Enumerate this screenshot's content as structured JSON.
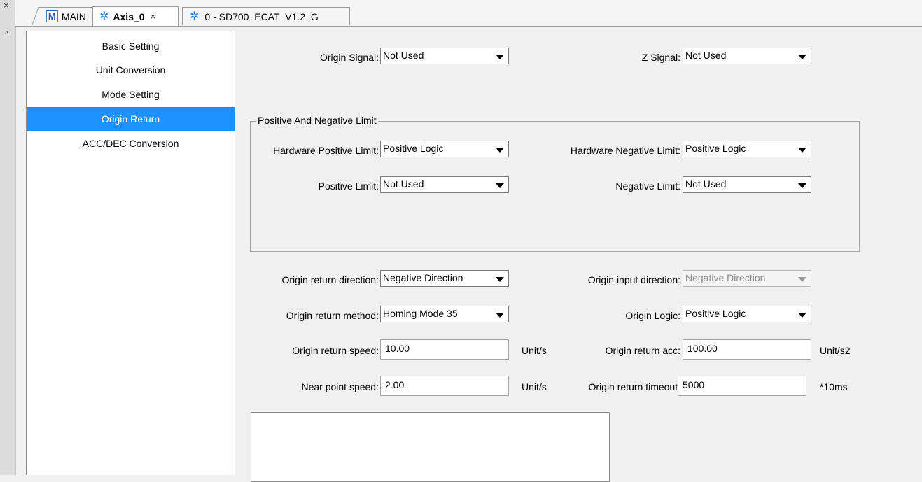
{
  "tabs": {
    "main_label": "MAIN",
    "axis_label": "Axis_0",
    "device_label": "0 - SD700_ECAT_V1.2_G",
    "close_glyph": "×"
  },
  "nav": {
    "items": [
      {
        "label": "Basic Setting"
      },
      {
        "label": "Unit Conversion"
      },
      {
        "label": "Mode Setting"
      },
      {
        "label": "Origin Return"
      },
      {
        "label": "ACC/DEC Conversion"
      }
    ],
    "selected_index": 3,
    "selected_color": "#1e90ff"
  },
  "form": {
    "origin_signal": {
      "label": "Origin Signal:",
      "value": "Not Used"
    },
    "z_signal": {
      "label": "Z Signal:",
      "value": "Not Used"
    },
    "limit_group": {
      "title": "Positive And Negative Limit",
      "hw_pos_limit": {
        "label": "Hardware Positive Limit:",
        "value": "Positive Logic"
      },
      "hw_neg_limit": {
        "label": "Hardware Negative Limit:",
        "value": "Positive Logic"
      },
      "pos_limit": {
        "label": "Positive Limit:",
        "value": "Not Used"
      },
      "neg_limit": {
        "label": "Negative Limit:",
        "value": "Not Used"
      }
    },
    "origin_return_direction": {
      "label": "Origin return direction:",
      "value": "Negative Direction"
    },
    "origin_input_direction": {
      "label": "Origin input direction:",
      "value": "Negative Direction",
      "disabled": true
    },
    "origin_return_method": {
      "label": "Origin return method:",
      "value": "Homing Mode 35"
    },
    "origin_logic": {
      "label": "Origin Logic:",
      "value": "Positive Logic"
    },
    "origin_return_speed": {
      "label": "Origin return speed:",
      "value": "10.00",
      "unit": "Unit/s"
    },
    "origin_return_acc": {
      "label": "Origin return acc:",
      "value": "100.00",
      "unit": "Unit/s2"
    },
    "near_point_speed": {
      "label": "Near point speed:",
      "value": "2.00",
      "unit": "Unit/s"
    },
    "origin_return_timeout": {
      "label": "Origin return timeout:",
      "value": "5000",
      "unit": "*10ms"
    }
  }
}
